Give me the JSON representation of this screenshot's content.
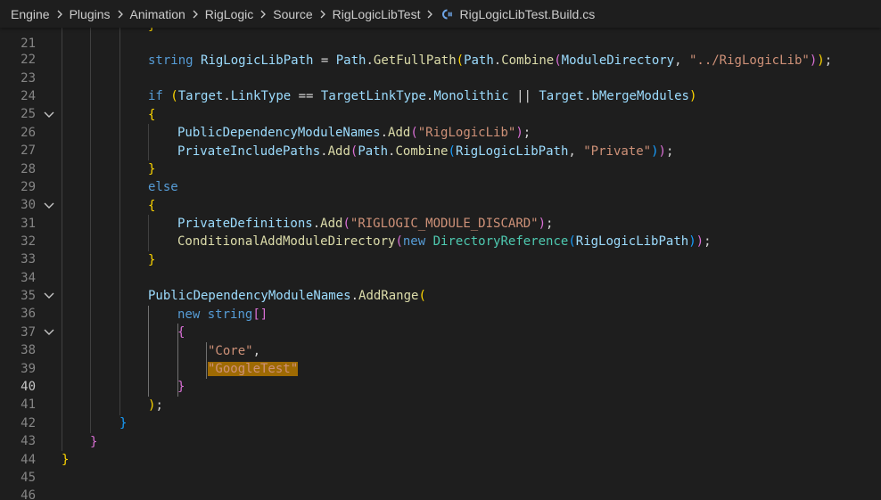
{
  "breadcrumb": {
    "items": [
      "Engine",
      "Plugins",
      "Animation",
      "RigLogic",
      "Source",
      "RigLogicLibTest"
    ],
    "file_icon": "csharp-file-icon",
    "file": "RigLogicLibTest.Build.cs"
  },
  "editor": {
    "active_line": 40,
    "lines": [
      {
        "n": "21",
        "fold": false
      },
      {
        "n": "22",
        "fold": false
      },
      {
        "n": "23",
        "fold": false
      },
      {
        "n": "24",
        "fold": false
      },
      {
        "n": "25",
        "fold": false
      },
      {
        "n": "26",
        "fold": true
      },
      {
        "n": "27",
        "fold": false
      },
      {
        "n": "28",
        "fold": false
      },
      {
        "n": "29",
        "fold": false
      },
      {
        "n": "30",
        "fold": false
      },
      {
        "n": "31",
        "fold": true
      },
      {
        "n": "32",
        "fold": false
      },
      {
        "n": "33",
        "fold": false
      },
      {
        "n": "34",
        "fold": false
      },
      {
        "n": "35",
        "fold": false
      },
      {
        "n": "36",
        "fold": true
      },
      {
        "n": "37",
        "fold": false
      },
      {
        "n": "38",
        "fold": true
      },
      {
        "n": "39",
        "fold": false
      },
      {
        "n": "40",
        "fold": false
      },
      {
        "n": "41",
        "fold": false
      },
      {
        "n": "42",
        "fold": false
      },
      {
        "n": "43",
        "fold": false
      },
      {
        "n": "44",
        "fold": false
      },
      {
        "n": "45",
        "fold": false
      },
      {
        "n": "46",
        "fold": false
      }
    ],
    "tokens": {
      "l21_brace": "}",
      "l23_string": "string",
      "l23_var": "RigLogicLibPath",
      "l23_eq": " = ",
      "l23_path1": "Path",
      "l23_dot1": ".",
      "l23_getfullpath": "GetFullPath",
      "l23_paren1": "(",
      "l23_path2": "Path",
      "l23_dot2": ".",
      "l23_combine": "Combine",
      "l23_paren2": "(",
      "l23_moddir": "ModuleDirectory",
      "l23_comma": ", ",
      "l23_str": "\"../RigLogicLib\"",
      "l23_paren2c": ")",
      "l23_paren1c": ")",
      "l23_semi": ";",
      "l25_if": "if",
      "l25_sp": " ",
      "l25_paren": "(",
      "l25_target1": "Target",
      "l25_dot1": ".",
      "l25_linktype": "LinkType",
      "l25_eqeq": " == ",
      "l25_tlt": "TargetLinkType",
      "l25_dot2": ".",
      "l25_mono": "Monolithic",
      "l25_or": " || ",
      "l25_target2": "Target",
      "l25_dot3": ".",
      "l25_bmerge": "bMergeModules",
      "l25_parenc": ")",
      "l26_brace": "{",
      "l27_pdmn": "PublicDependencyModuleNames",
      "l27_dot": ".",
      "l27_add": "Add",
      "l27_paren": "(",
      "l27_str": "\"RigLogicLib\"",
      "l27_parenc": ")",
      "l27_semi": ";",
      "l28_pip": "PrivateIncludePaths",
      "l28_dot1": ".",
      "l28_add": "Add",
      "l28_paren1": "(",
      "l28_path": "Path",
      "l28_dot2": ".",
      "l28_combine": "Combine",
      "l28_paren2": "(",
      "l28_var": "RigLogicLibPath",
      "l28_comma": ", ",
      "l28_str": "\"Private\"",
      "l28_paren2c": ")",
      "l28_paren1c": ")",
      "l28_semi": ";",
      "l29_brace": "}",
      "l30_else": "else",
      "l31_brace": "{",
      "l32_pd": "PrivateDefinitions",
      "l32_dot": ".",
      "l32_add": "Add",
      "l32_paren": "(",
      "l32_str": "\"RIGLOGIC_MODULE_DISCARD\"",
      "l32_parenc": ")",
      "l32_semi": ";",
      "l33_camd": "ConditionalAddModuleDirectory",
      "l33_paren1": "(",
      "l33_new": "new",
      "l33_sp": " ",
      "l33_dirref": "DirectoryReference",
      "l33_paren2": "(",
      "l33_var": "RigLogicLibPath",
      "l33_paren2c": ")",
      "l33_paren1c": ")",
      "l33_semi": ";",
      "l34_brace": "}",
      "l36_pdmn": "PublicDependencyModuleNames",
      "l36_dot": ".",
      "l36_addrange": "AddRange",
      "l36_paren": "(",
      "l37_new": "new",
      "l37_sp": " ",
      "l37_string": "string",
      "l37_brackets": "[]",
      "l38_brace": "{",
      "l39_str": "\"Core\"",
      "l39_comma": ",",
      "l40_str": "\"GoogleTest\"",
      "l41_brace": "}",
      "l42_paren": ")",
      "l42_semi": ";",
      "l43_brace": "}",
      "l44_brace": "}",
      "l45_brace": "}"
    }
  },
  "colors": {
    "background": "#1e1e1e",
    "keyword": "#569cd6",
    "type": "#4ec9b0",
    "variable": "#9cdcfe",
    "function": "#dcdcaa",
    "string": "#ce9178",
    "bracket_gold": "#ffd700",
    "bracket_orchid": "#da70d6",
    "bracket_blue": "#179fff",
    "highlight": "#9e6a03"
  }
}
